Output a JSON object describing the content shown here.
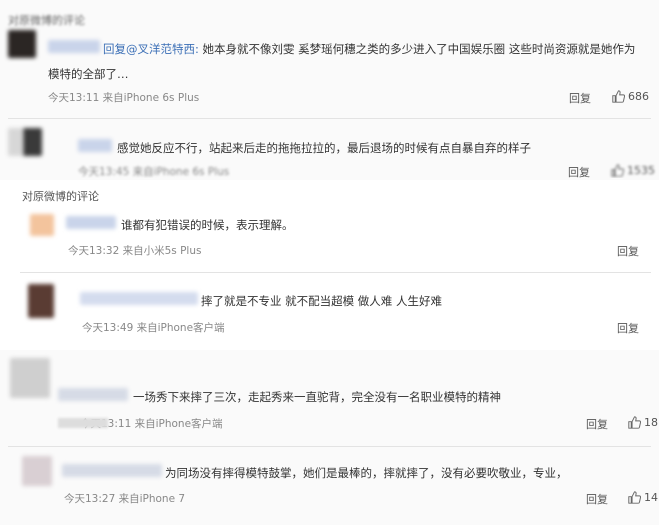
{
  "section_header": "对原微博的评论",
  "top": [
    {
      "mention": "回复@叉洋范特西:",
      "text_line1": "她本身就不像刘雯 奚梦瑶何穗之类的多少进入了中国娱乐圈 这些时尚资源就是她作为",
      "text_line2": "模特的全部了…",
      "meta": "今天13:11 来自iPhone 6s Plus",
      "reply": "回复",
      "likes": "686"
    },
    {
      "text": "感觉她反应不行，站起来后走的拖拖拉拉的，最后退场的时候有点自暴自弃的样子",
      "meta": "今天13:45 来自iPhone 6s Plus",
      "reply": "回复",
      "likes": "1535"
    }
  ],
  "middle": [
    {
      "text": "谁都有犯错误的时候，表示理解。",
      "meta": "今天13:32 来自小米5s Plus",
      "reply": "回复"
    },
    {
      "text": "摔了就是不专业 就不配当超模 做人难 人生好难",
      "meta": "今天13:49 来自iPhone客户端",
      "reply": "回复"
    }
  ],
  "bottom": [
    {
      "text": "一场秀下来摔了三次，走起秀来一直驼背，完全没有一名职业模特的精神",
      "meta": "今天13:11 来自iPhone客户端",
      "reply": "回复",
      "likes": "18"
    },
    {
      "text": "为同场没有摔得模特鼓掌，她们是最棒的，摔就摔了，没有必要吹敬业，专业，",
      "meta": "今天13:27 来自iPhone 7",
      "reply": "回复",
      "likes": "14"
    }
  ]
}
